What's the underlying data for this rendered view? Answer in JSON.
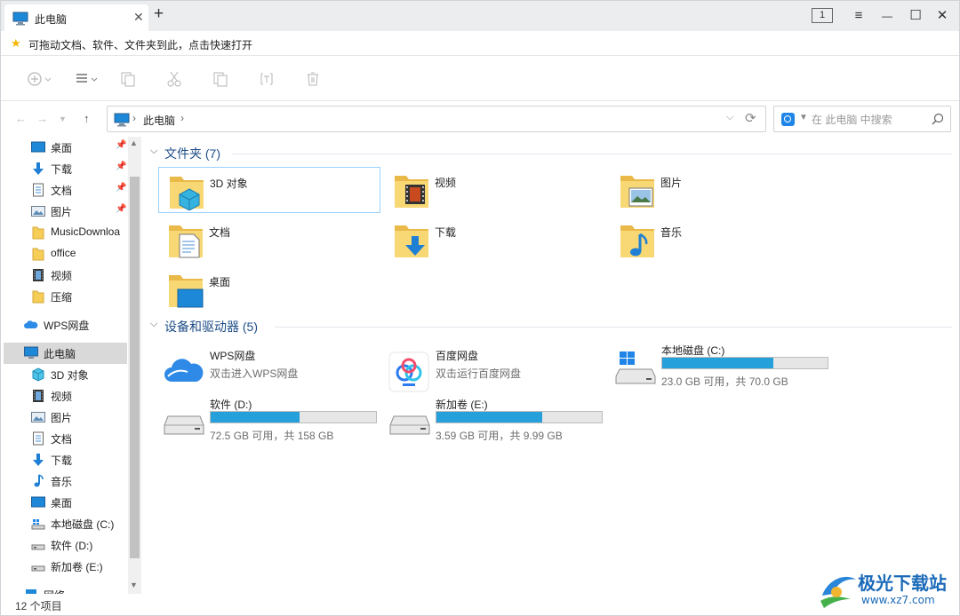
{
  "tab": {
    "title": "此电脑",
    "close": "✕",
    "add": "+",
    "count": "1"
  },
  "window_controls": {
    "menu": "≡",
    "minimize": "—",
    "maximize": "☐",
    "close": "✕"
  },
  "hint": {
    "text": "可拖动文档、软件、文件夹到此，点击快速打开"
  },
  "address": {
    "path": "此电脑",
    "sep": "›"
  },
  "search": {
    "placeholder": "在 此电脑 中搜索"
  },
  "sidebar": {
    "items": [
      {
        "label": "桌面",
        "icon": "desktop-icon",
        "pinned": true
      },
      {
        "label": "下载",
        "icon": "download-icon",
        "pinned": true
      },
      {
        "label": "文档",
        "icon": "document-icon",
        "pinned": true
      },
      {
        "label": "图片",
        "icon": "picture-icon",
        "pinned": true
      },
      {
        "label": "MusicDownloa",
        "icon": "folder-icon",
        "pinned": false
      },
      {
        "label": "office",
        "icon": "folder-icon",
        "pinned": false
      },
      {
        "label": "视频",
        "icon": "video-icon",
        "pinned": false
      },
      {
        "label": "压缩",
        "icon": "folder-icon",
        "pinned": false
      },
      {
        "label": "WPS网盘",
        "icon": "wps-cloud-icon",
        "pinned": false
      },
      {
        "label": "此电脑",
        "icon": "computer-icon",
        "pinned": false
      },
      {
        "label": "3D 对象",
        "icon": "3d-objects-icon",
        "pinned": false
      },
      {
        "label": "视频",
        "icon": "video-icon",
        "pinned": false
      },
      {
        "label": "图片",
        "icon": "picture-icon",
        "pinned": false
      },
      {
        "label": "文档",
        "icon": "document-icon",
        "pinned": false
      },
      {
        "label": "下载",
        "icon": "download-icon",
        "pinned": false
      },
      {
        "label": "音乐",
        "icon": "music-icon",
        "pinned": false
      },
      {
        "label": "桌面",
        "icon": "desktop-icon",
        "pinned": false
      },
      {
        "label": "本地磁盘 (C:)",
        "icon": "drive-c-icon",
        "pinned": false
      },
      {
        "label": "软件 (D:)",
        "icon": "drive-icon",
        "pinned": false
      },
      {
        "label": "新加卷 (E:)",
        "icon": "drive-icon",
        "pinned": false
      },
      {
        "label": "网络",
        "icon": "network-icon",
        "pinned": false
      }
    ]
  },
  "groups": {
    "folders": {
      "title": "文件夹 (7)"
    },
    "drives": {
      "title": "设备和驱动器 (5)"
    }
  },
  "folders": [
    {
      "name": "3D 对象",
      "icon": "3d-objects-icon"
    },
    {
      "name": "视频",
      "icon": "video-icon"
    },
    {
      "name": "图片",
      "icon": "picture-icon"
    },
    {
      "name": "文档",
      "icon": "document-icon"
    },
    {
      "name": "下载",
      "icon": "download-icon"
    },
    {
      "name": "音乐",
      "icon": "music-icon"
    },
    {
      "name": "桌面",
      "icon": "desktop-icon"
    }
  ],
  "drives": [
    {
      "name": "WPS网盘",
      "subtitle": "双击进入WPS网盘",
      "icon": "wps-cloud-icon"
    },
    {
      "name": "百度网盘",
      "subtitle": "双击运行百度网盘",
      "icon": "baidu-netdisk-icon"
    },
    {
      "name": "本地磁盘 (C:)",
      "space": "23.0 GB 可用，共 70.0 GB",
      "used_fraction": 0.67,
      "icon": "drive-c-icon"
    },
    {
      "name": "软件 (D:)",
      "space": "72.5 GB 可用，共 158 GB",
      "used_fraction": 0.54,
      "icon": "drive-icon"
    },
    {
      "name": "新加卷 (E:)",
      "space": "3.59 GB 可用，共 9.99 GB",
      "used_fraction": 0.64,
      "icon": "drive-icon"
    }
  ],
  "status": {
    "items": "12 个项目"
  },
  "watermark": {
    "title": "极光下载站",
    "url": "www.xz7.com"
  },
  "colors": {
    "accent": "#26a0da",
    "selection": "#99d1ff",
    "group_header": "#1e4d87"
  }
}
